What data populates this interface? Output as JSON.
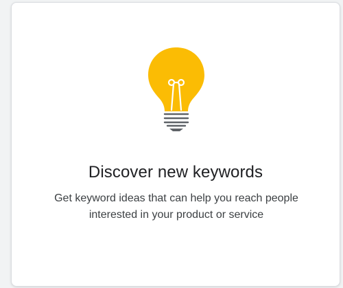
{
  "card": {
    "icon": "lightbulb-icon",
    "title": "Discover new keywords",
    "description": "Get keyword ideas that can help you reach people interested in your product or service"
  },
  "colors": {
    "bulb": "#fbbc04",
    "filament": "#ffffff",
    "base": "#5f6368",
    "title_text": "#202124",
    "body_text": "#3c4043",
    "border": "#dadce0"
  }
}
